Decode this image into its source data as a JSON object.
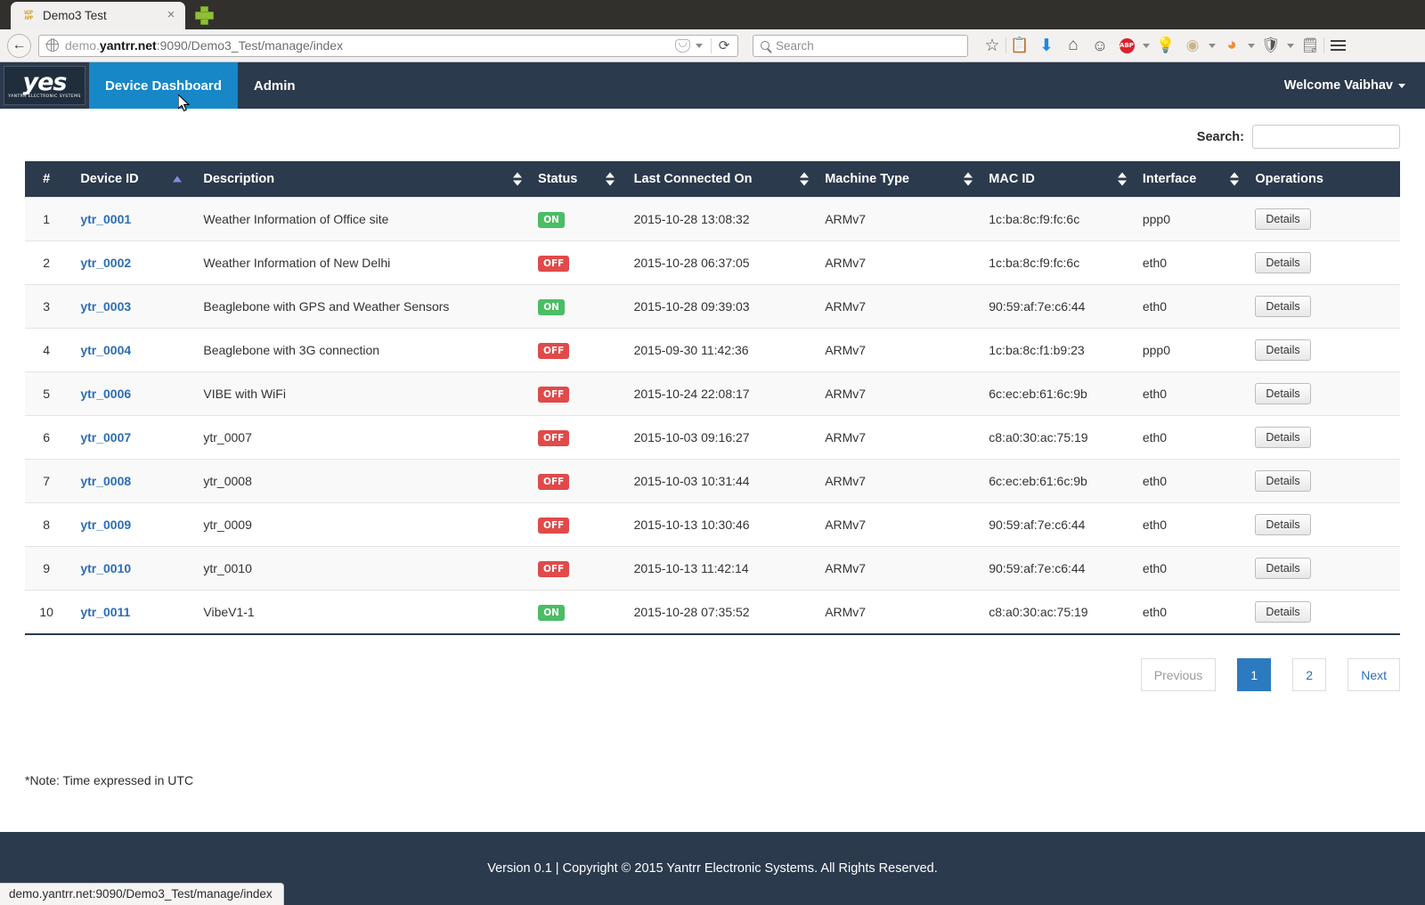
{
  "browser": {
    "tab": {
      "title": "Demo3 Test",
      "favicon_line1": "W2P",
      "favicon_line2": "APP",
      "close_label": "×"
    },
    "new_tab_label": "new-tab",
    "back_label": "←",
    "url": {
      "prefix": "demo.",
      "host": "yantrr.net",
      "rest": ":9090/Demo3_Test/manage/index"
    },
    "reload_label": "⟳",
    "search": {
      "placeholder": "Search"
    },
    "toolbar_icons": [
      {
        "name": "bookmark-star-icon",
        "glyph": "☆"
      },
      {
        "name": "reader-list-icon",
        "glyph": "⌸"
      },
      {
        "name": "downloads-icon",
        "glyph": "⬇"
      },
      {
        "name": "home-icon",
        "glyph": "⌂"
      },
      {
        "name": "hello-smiley-icon",
        "glyph": "☺"
      },
      {
        "name": "adblock-plus-icon",
        "glyph": "ABP"
      },
      {
        "name": "lightbulb-icon",
        "glyph": "💡"
      },
      {
        "name": "ghostery-icon",
        "glyph": "◕"
      },
      {
        "name": "rainbow-icon",
        "glyph": "◜"
      },
      {
        "name": "shield-icon",
        "glyph": "⛉"
      },
      {
        "name": "notepad-icon",
        "glyph": "🗒"
      },
      {
        "name": "menu-hamburger-icon",
        "glyph": "☰"
      }
    ],
    "status_bar_url": "demo.yantrr.net:9090/Demo3_Test/manage/index"
  },
  "navbar": {
    "brand": {
      "logo_text": "yes",
      "subtitle": "YANTRR ELECTRONIC SYSTEMS"
    },
    "links": [
      {
        "label": "Device Dashboard",
        "active": true
      },
      {
        "label": "Admin",
        "active": false
      }
    ],
    "user_menu": "Welcome Vaibhav"
  },
  "main": {
    "search": {
      "label": "Search:",
      "value": "",
      "placeholder": ""
    },
    "table": {
      "columns": [
        {
          "key": "idx",
          "label": "#",
          "sortable": false,
          "sort": "none"
        },
        {
          "key": "devid",
          "label": "Device ID",
          "sortable": true,
          "sort": "asc"
        },
        {
          "key": "desc",
          "label": "Description",
          "sortable": true,
          "sort": "both"
        },
        {
          "key": "status",
          "label": "Status",
          "sortable": true,
          "sort": "both"
        },
        {
          "key": "last",
          "label": "Last Connected On",
          "sortable": true,
          "sort": "both"
        },
        {
          "key": "mach",
          "label": "Machine Type",
          "sortable": true,
          "sort": "both"
        },
        {
          "key": "mac",
          "label": "MAC ID",
          "sortable": true,
          "sort": "both"
        },
        {
          "key": "iface",
          "label": "Interface",
          "sortable": true,
          "sort": "both"
        },
        {
          "key": "ops",
          "label": "Operations",
          "sortable": false,
          "sort": "none"
        }
      ],
      "details_button_label": "Details",
      "rows": [
        {
          "idx": "1",
          "devid": "ytr_0001",
          "desc": "Weather Information of Office site",
          "status": "ON",
          "last": "2015-10-28 13:08:32",
          "mach": "ARMv7",
          "mac": "1c:ba:8c:f9:fc:6c",
          "iface": "ppp0"
        },
        {
          "idx": "2",
          "devid": "ytr_0002",
          "desc": "Weather Information of New Delhi",
          "status": "OFF",
          "last": "2015-10-28 06:37:05",
          "mach": "ARMv7",
          "mac": "1c:ba:8c:f9:fc:6c",
          "iface": "eth0"
        },
        {
          "idx": "3",
          "devid": "ytr_0003",
          "desc": "Beaglebone with GPS and Weather Sensors",
          "status": "ON",
          "last": "2015-10-28 09:39:03",
          "mach": "ARMv7",
          "mac": "90:59:af:7e:c6:44",
          "iface": "eth0"
        },
        {
          "idx": "4",
          "devid": "ytr_0004",
          "desc": "Beaglebone with 3G connection",
          "status": "OFF",
          "last": "2015-09-30 11:42:36",
          "mach": "ARMv7",
          "mac": "1c:ba:8c:f1:b9:23",
          "iface": "ppp0"
        },
        {
          "idx": "5",
          "devid": "ytr_0006",
          "desc": "VIBE with WiFi",
          "status": "OFF",
          "last": "2015-10-24 22:08:17",
          "mach": "ARMv7",
          "mac": "6c:ec:eb:61:6c:9b",
          "iface": "eth0"
        },
        {
          "idx": "6",
          "devid": "ytr_0007",
          "desc": "ytr_0007",
          "status": "OFF",
          "last": "2015-10-03 09:16:27",
          "mach": "ARMv7",
          "mac": "c8:a0:30:ac:75:19",
          "iface": "eth0"
        },
        {
          "idx": "7",
          "devid": "ytr_0008",
          "desc": "ytr_0008",
          "status": "OFF",
          "last": "2015-10-03 10:31:44",
          "mach": "ARMv7",
          "mac": "6c:ec:eb:61:6c:9b",
          "iface": "eth0"
        },
        {
          "idx": "8",
          "devid": "ytr_0009",
          "desc": "ytr_0009",
          "status": "OFF",
          "last": "2015-10-13 10:30:46",
          "mach": "ARMv7",
          "mac": "90:59:af:7e:c6:44",
          "iface": "eth0"
        },
        {
          "idx": "9",
          "devid": "ytr_0010",
          "desc": "ytr_0010",
          "status": "OFF",
          "last": "2015-10-13 11:42:14",
          "mach": "ARMv7",
          "mac": "90:59:af:7e:c6:44",
          "iface": "eth0"
        },
        {
          "idx": "10",
          "devid": "ytr_0011",
          "desc": "VibeV1-1",
          "status": "ON",
          "last": "2015-10-28 07:35:52",
          "mach": "ARMv7",
          "mac": "c8:a0:30:ac:75:19",
          "iface": "eth0"
        }
      ]
    },
    "pagination": {
      "previous": "Previous",
      "pages": [
        "1",
        "2"
      ],
      "active_page": "1",
      "next": "Next"
    },
    "note": "*Note: Time expressed in UTC"
  },
  "footer": {
    "text": "Version 0.1 | Copyright © 2015 Yantrr Electronic Systems. All Rights Reserved."
  },
  "colors": {
    "navy": "#2b3a4c",
    "accent_blue": "#1787c8",
    "link_blue": "#2c6eb5",
    "status_on": "#4bbd63",
    "status_off": "#e04a49",
    "page_active": "#2c7ac0"
  }
}
